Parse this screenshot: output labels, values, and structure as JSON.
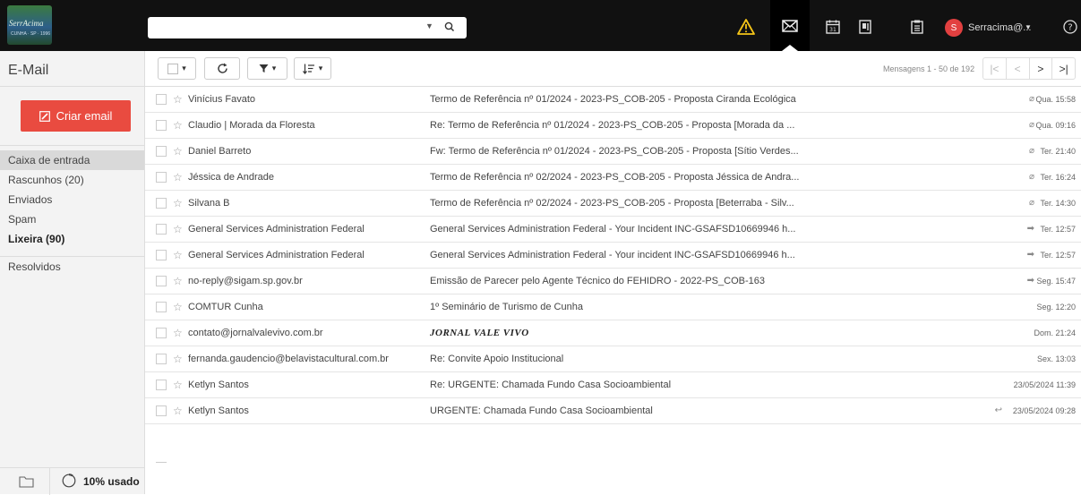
{
  "app": {
    "logo_text": "SerrAcima",
    "logo_sub": "CUNHA · SP · 1996"
  },
  "search": {
    "value": "",
    "placeholder": ""
  },
  "topbar": {
    "icons": [
      "warning-icon",
      "mail-icon",
      "calendar-icon",
      "contacts-icon",
      "tasks-icon"
    ],
    "calendar_day": "31",
    "user_initial": "S",
    "user_name": "Serracima@...",
    "help_icon": "help-icon",
    "warning_color": "#f5c518",
    "avatar_color": "#e24040"
  },
  "sidebar": {
    "title": "E-Mail",
    "compose_label": "Criar email",
    "compose_color": "#e94b40",
    "folders": [
      {
        "label": "Caixa de entrada",
        "selected": true,
        "bold": false
      },
      {
        "label": "Rascunhos (20)",
        "selected": false,
        "bold": false
      },
      {
        "label": "Enviados",
        "selected": false,
        "bold": false
      },
      {
        "label": "Spam",
        "selected": false,
        "bold": false
      },
      {
        "label": "Lixeira (90)",
        "selected": false,
        "bold": true
      }
    ],
    "extra_folders": [
      {
        "label": "Resolvidos"
      }
    ],
    "quota_label": "10% usado",
    "quota_percent": 10
  },
  "toolbar": {
    "select_caret": "▾",
    "refresh_icon": "refresh-icon",
    "filter_icon": "filter-icon",
    "sort_icon": "sort-icon"
  },
  "pager": {
    "text": "Mensagens 1 - 50 de 192",
    "first": "|<",
    "prev": "<",
    "next": ">",
    "last": ">|"
  },
  "messages": [
    {
      "from": "Vinícius Favato",
      "subject": "Termo de Referência nº 01/2024 - 2023-PS_COB-205 - Proposta Ciranda Ecológica",
      "flag": "attachment",
      "date": "Qua. 15:58"
    },
    {
      "from": "Claudio | Morada da Floresta",
      "subject": "Re: Termo de Referência nº 01/2024 - 2023-PS_COB-205 - Proposta [Morada da ...",
      "flag": "attachment",
      "date": "Qua. 09:16"
    },
    {
      "from": "Daniel Barreto",
      "subject": "Fw: Termo de Referência nº 01/2024 - 2023-PS_COB-205 - Proposta [Sítio Verdes...",
      "flag": "attachment",
      "date": "Ter. 21:40"
    },
    {
      "from": "Jéssica de Andrade",
      "subject": "Termo de Referência nº 02/2024 - 2023-PS_COB-205 - Proposta Jéssica de Andra...",
      "flag": "attachment",
      "date": "Ter. 16:24"
    },
    {
      "from": "Silvana B",
      "subject": "Termo de Referência nº 02/2024 - 2023-PS_COB-205 - Proposta [Beterraba - Silv...",
      "flag": "attachment",
      "date": "Ter. 14:30"
    },
    {
      "from": "General Services Administration Federal",
      "subject": "General Services Administration Federal - Your Incident INC-GSAFSD10669946 h...",
      "flag": "forwarded",
      "date": "Ter. 12:57"
    },
    {
      "from": "General Services Administration Federal",
      "subject": "General Services Administration Federal - Your incident INC-GSAFSD10669946 h...",
      "flag": "forwarded",
      "date": "Ter. 12:57"
    },
    {
      "from": "no-reply@sigam.sp.gov.br",
      "subject": "Emissão de Parecer pelo Agente Técnico do FEHIDRO - 2022-PS_COB-163",
      "flag": "forwarded",
      "date": "Seg. 15:47"
    },
    {
      "from": "COMTUR Cunha",
      "subject": "1º Seminário de Turismo de Cunha",
      "flag": "",
      "date": "Seg. 12:20"
    },
    {
      "from": "contato@jornalvalevivo.com.br",
      "subject": "JORNAL VALE VIVO",
      "flag": "",
      "date": "Dom. 21:24",
      "special": true
    },
    {
      "from": "fernanda.gaudencio@belavistacultural.com.br",
      "subject": "Re: Convite Apoio Institucional",
      "flag": "",
      "date": "Sex. 13:03"
    },
    {
      "from": "Ketlyn Santos",
      "subject": "Re: URGENTE: Chamada Fundo Casa Socioambiental",
      "flag": "",
      "date": "23/05/2024 11:39"
    },
    {
      "from": "Ketlyn Santos",
      "subject": "URGENTE: Chamada Fundo Casa Socioambiental",
      "flag": "replied",
      "date": "23/05/2024 09:28"
    }
  ]
}
